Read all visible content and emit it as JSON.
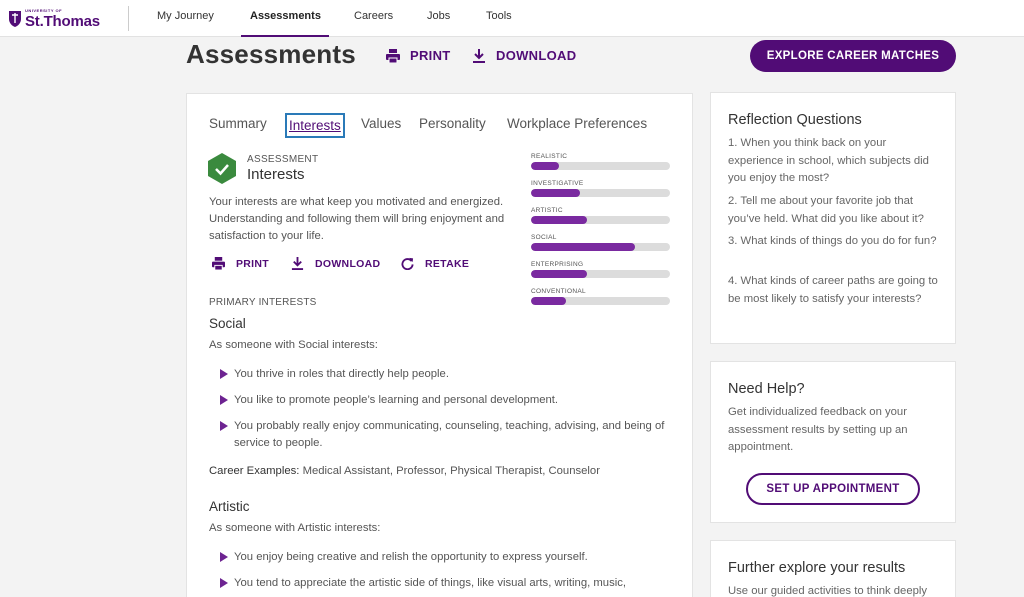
{
  "brand": {
    "logo_small": "UNIVERSITY OF",
    "logo_big": "St.Thomas",
    "color": "#510c76"
  },
  "nav": {
    "items": [
      "My Journey",
      "Assessments",
      "Careers",
      "Jobs",
      "Tools"
    ],
    "active": "Assessments"
  },
  "header": {
    "title": "Assessments",
    "print": "PRINT",
    "download": "DOWNLOAD",
    "cta": "EXPLORE CAREER MATCHES"
  },
  "tabs": [
    "Summary",
    "Interests",
    "Values",
    "Personality",
    "Workplace Preferences"
  ],
  "active_tab": "Interests",
  "assessment": {
    "label": "ASSESSMENT",
    "name": "Interests",
    "description": "Your interests are what keep you motivated and energized. Understanding and following them will bring enjoyment and satisfaction to your life.",
    "actions": [
      "PRINT",
      "DOWNLOAD",
      "RETAKE"
    ]
  },
  "interest_bars": [
    {
      "label": "REALISTIC",
      "level": 0.2
    },
    {
      "label": "INVESTIGATIVE",
      "level": 0.35
    },
    {
      "label": "ARTISTIC",
      "level": 0.4
    },
    {
      "label": "SOCIAL",
      "level": 0.75
    },
    {
      "label": "ENTERPRISING",
      "level": 0.4
    },
    {
      "label": "CONVENTIONAL",
      "level": 0.25
    }
  ],
  "primary": {
    "label": "PRIMARY INTERESTS",
    "social": {
      "title": "Social",
      "intro": "As someone with Social interests:",
      "bullets": [
        "You thrive in roles that directly help people.",
        "You like to promote people’s learning and personal development.",
        "You probably really enjoy communicating, counseling, teaching, advising, and being of service to people."
      ],
      "examples_label": "Career Examples:",
      "examples": "Medical Assistant, Professor, Physical Therapist, Counselor"
    },
    "artistic": {
      "title": "Artistic",
      "intro": "As someone with Artistic interests:",
      "bullets": [
        "You enjoy being creative and relish the opportunity to express yourself.",
        "You tend to appreciate the artistic side of things, like visual arts, writing, music,"
      ]
    }
  },
  "reflection": {
    "title": "Reflection Questions",
    "questions": [
      "1. When you think back on your experience in school, which subjects did you enjoy the most?",
      "2. Tell me about your favorite job that you’ve held. What did you like about it?",
      "3. What kinds of things do you do for fun?",
      "4. What kinds of career paths are going to be most likely to satisfy your interests?"
    ]
  },
  "help": {
    "title": "Need Help?",
    "text": "Get individualized feedback on your assessment results by setting up an appointment.",
    "button": "SET UP APPOINTMENT"
  },
  "explore": {
    "title": "Further explore your results",
    "text": "Use our guided activities to think deeply"
  }
}
